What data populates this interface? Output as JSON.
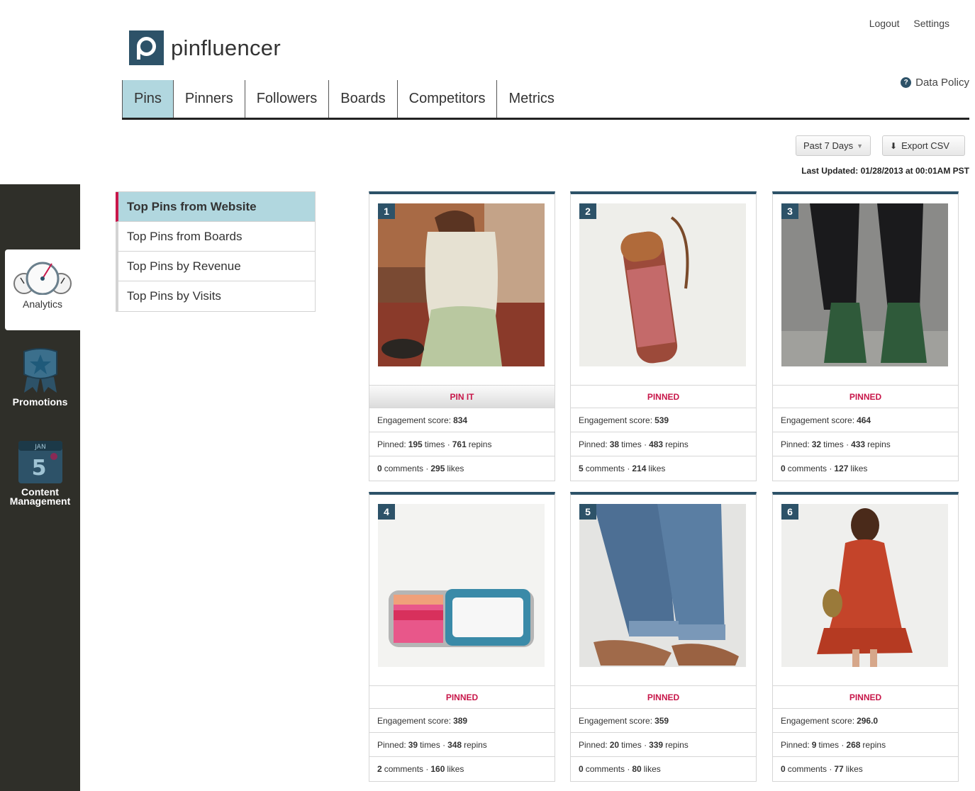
{
  "top_links": {
    "logout": "Logout",
    "settings": "Settings"
  },
  "brand": {
    "name": "pinfluencer",
    "color": "#2d5268"
  },
  "data_policy": "Data Policy",
  "tabs": [
    {
      "label": "Pins",
      "active": true
    },
    {
      "label": "Pinners",
      "active": false
    },
    {
      "label": "Followers",
      "active": false
    },
    {
      "label": "Boards",
      "active": false
    },
    {
      "label": "Competitors",
      "active": false
    },
    {
      "label": "Metrics",
      "active": false
    }
  ],
  "controls": {
    "range": "Past 7 Days",
    "export": "Export CSV"
  },
  "last_updated": "Last Updated: 01/28/2013 at 00:01AM PST",
  "sidebar": {
    "analytics": "Analytics",
    "promotions": "Promotions",
    "content_line1": "Content",
    "content_line2": "Management",
    "calendar_month": "JAN",
    "calendar_day": "5"
  },
  "submenu": [
    {
      "label": "Top Pins from Website",
      "active": true
    },
    {
      "label": "Top Pins from Boards",
      "active": false
    },
    {
      "label": "Top Pins by Revenue",
      "active": false
    },
    {
      "label": "Top Pins by Visits",
      "active": false
    }
  ],
  "labels": {
    "engagement": "Engagement score:",
    "pinned": "Pinned:",
    "times": "times ·",
    "repins": "repins",
    "comments": "comments ·",
    "likes": "likes"
  },
  "pins": [
    {
      "rank": "1",
      "status": "PIN IT",
      "engagement": "834",
      "pinned": "195",
      "repins": "761",
      "comments": "0",
      "likes": "295"
    },
    {
      "rank": "2",
      "status": "PINNED",
      "engagement": "539",
      "pinned": "38",
      "repins": "483",
      "comments": "5",
      "likes": "214"
    },
    {
      "rank": "3",
      "status": "PINNED",
      "engagement": "464",
      "pinned": "32",
      "repins": "433",
      "comments": "0",
      "likes": "127"
    },
    {
      "rank": "4",
      "status": "PINNED",
      "engagement": "389",
      "pinned": "39",
      "repins": "348",
      "comments": "2",
      "likes": "160"
    },
    {
      "rank": "5",
      "status": "PINNED",
      "engagement": "359",
      "pinned": "20",
      "repins": "339",
      "comments": "0",
      "likes": "80"
    },
    {
      "rank": "6",
      "status": "PINNED",
      "engagement": "296.0",
      "pinned": "9",
      "repins": "268",
      "comments": "0",
      "likes": "77"
    }
  ],
  "colors": {
    "accent": "#c8174a",
    "tab_active": "#b1d7df",
    "sidebar_bg": "#2f2f29"
  }
}
